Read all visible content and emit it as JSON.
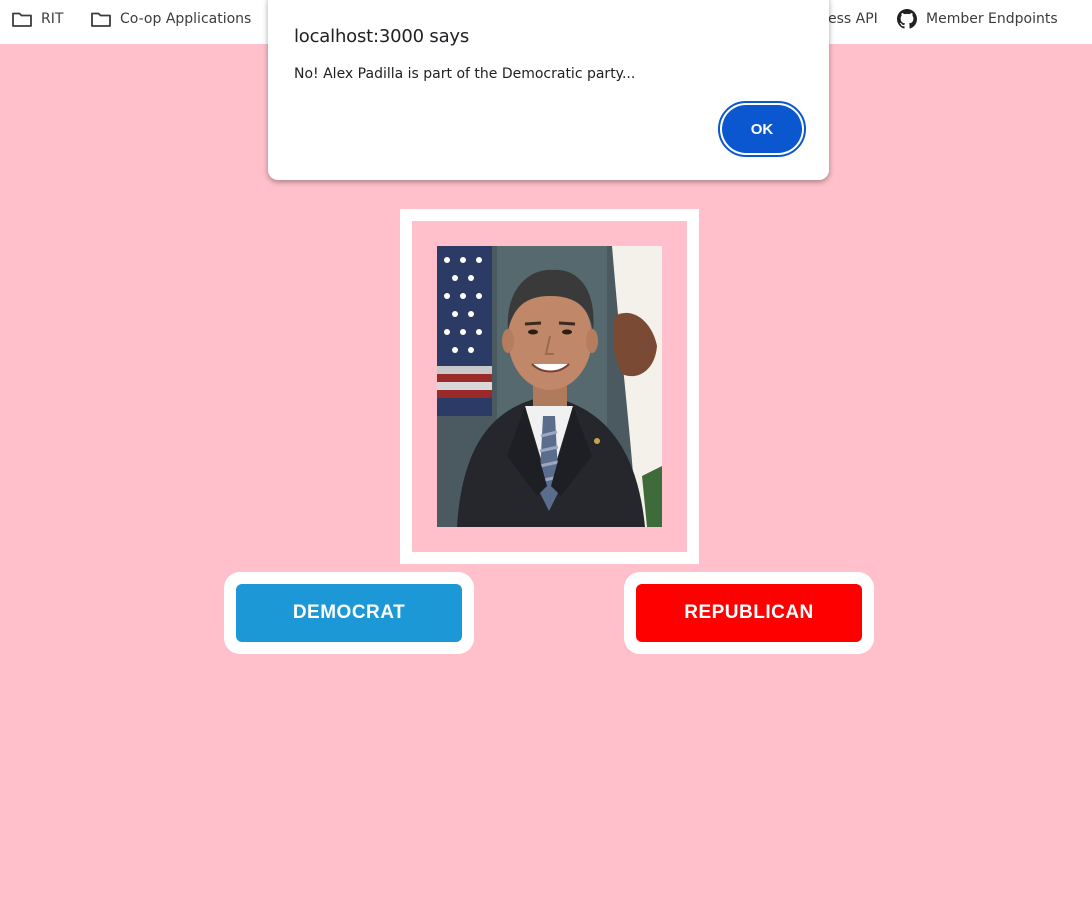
{
  "bookmarks": [
    {
      "label": "RIT",
      "icon": "folder-icon"
    },
    {
      "label": "Co-op Applications",
      "icon": "folder-icon"
    },
    {
      "label": "ess API",
      "icon": null
    },
    {
      "label": "Member Endpoints",
      "icon": "github-icon"
    }
  ],
  "dialog": {
    "title": "localhost:3000 says",
    "message": "No! Alex Padilla is part of the Democratic party...",
    "ok_label": "OK"
  },
  "game": {
    "portrait_icon": "senator-portrait",
    "democrat_label": "DEMOCRAT",
    "republican_label": "REPUBLICAN"
  },
  "colors": {
    "background": "#ffc0cb",
    "democrat": "#1b98d5",
    "republican": "#ff0000",
    "ok_button": "#0b57d0"
  }
}
